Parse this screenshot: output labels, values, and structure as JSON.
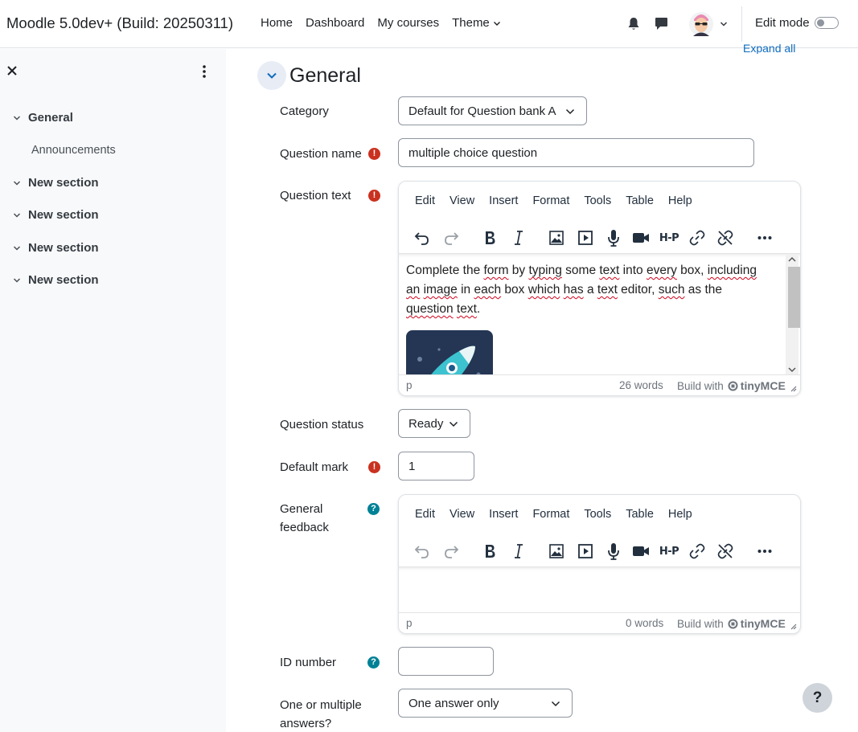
{
  "navbar": {
    "brand": "Moodle 5.0dev+ (Build: 20250311)",
    "links": [
      "Home",
      "Dashboard",
      "My courses",
      "Theme"
    ],
    "edit_mode_label": "Edit mode",
    "edit_mode_on": false
  },
  "drawer": {
    "items": [
      {
        "label": "General"
      },
      {
        "label": "Announcements"
      },
      {
        "label": "New section"
      },
      {
        "label": "New section"
      },
      {
        "label": "New section"
      },
      {
        "label": "New section"
      }
    ]
  },
  "main": {
    "expand_all": "Expand all",
    "section_title": "General",
    "category": {
      "label": "Category",
      "value": "Default for Question bank A"
    },
    "question_name": {
      "label": "Question name",
      "value": "multiple choice question"
    },
    "question_text": {
      "label": "Question text",
      "word_count": "26 words",
      "path": "p"
    },
    "question_status": {
      "label": "Question status",
      "value": "Ready"
    },
    "default_mark": {
      "label": "Default mark",
      "value": "1"
    },
    "general_feedback": {
      "label_line1": "General",
      "label_line2": "feedback",
      "word_count": "0 words",
      "path": "p"
    },
    "id_number": {
      "label": "ID number",
      "value": ""
    },
    "answers": {
      "label_line1": "One or multiple",
      "label_line2": "answers?",
      "value": "One answer only"
    }
  },
  "editor": {
    "menu": [
      "Edit",
      "View",
      "Insert",
      "Format",
      "Tools",
      "Table",
      "Help"
    ],
    "build_with": "Build with",
    "brand": "tinyMCE",
    "h5p": "H-P"
  },
  "content": {
    "w1": "Complete the ",
    "w2": "form",
    "w3": " by ",
    "w4": "typing",
    "w5": " some ",
    "w6": "text",
    "w7": " into ",
    "w8": "every",
    "w9": " box, ",
    "w10": "including",
    "w11": "an",
    "w12": " ",
    "w13": "image",
    "w14": " in ",
    "w15": "each",
    "w16": " box ",
    "w17": "which",
    "w18": " ",
    "w19": "has",
    "w20": " a ",
    "w21": "text",
    "w22": " editor, ",
    "w23": "such",
    "w24": " as the",
    "w25": "question",
    "w26": " ",
    "w27": "text",
    "w28": "."
  },
  "help_fab": "?",
  "colors": {
    "accent": "#0f6cbf",
    "required": "#ca3120",
    "help": "#008196"
  }
}
